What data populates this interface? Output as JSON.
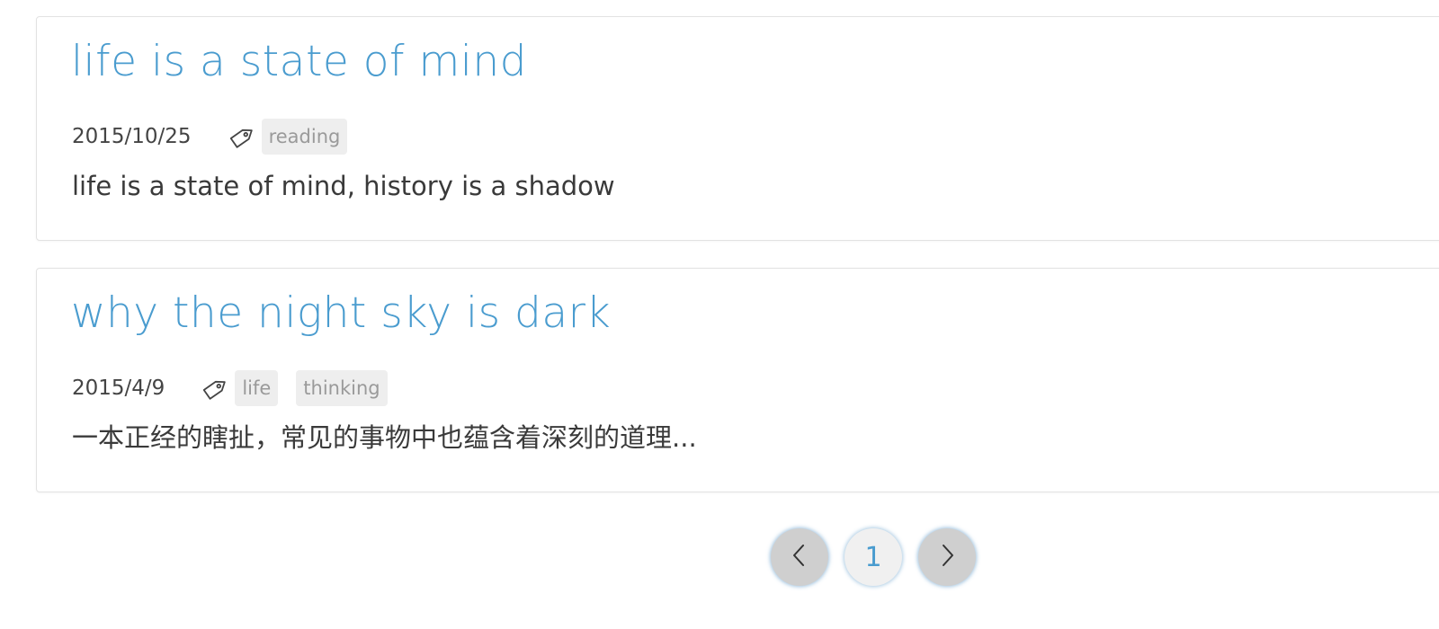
{
  "posts": [
    {
      "title": "life is a state of mind",
      "date": "2015/10/25",
      "tags": [
        "reading"
      ],
      "excerpt": "life is a state of mind, history is a shadow"
    },
    {
      "title": "why the night sky is dark",
      "date": "2015/4/9",
      "tags": [
        "life",
        "thinking"
      ],
      "excerpt": "一本正经的瞎扯，常见的事物中也蕴含着深刻的道理..."
    }
  ],
  "pagination": {
    "prev_icon": "chevron-left-icon",
    "current_page": "1",
    "next_icon": "chevron-right-icon"
  },
  "colors": {
    "title": "#4a9ccf",
    "tag_bg": "#eeeeee",
    "tag_text": "#9a9a9a",
    "nav_button": "#cfcfcf"
  }
}
